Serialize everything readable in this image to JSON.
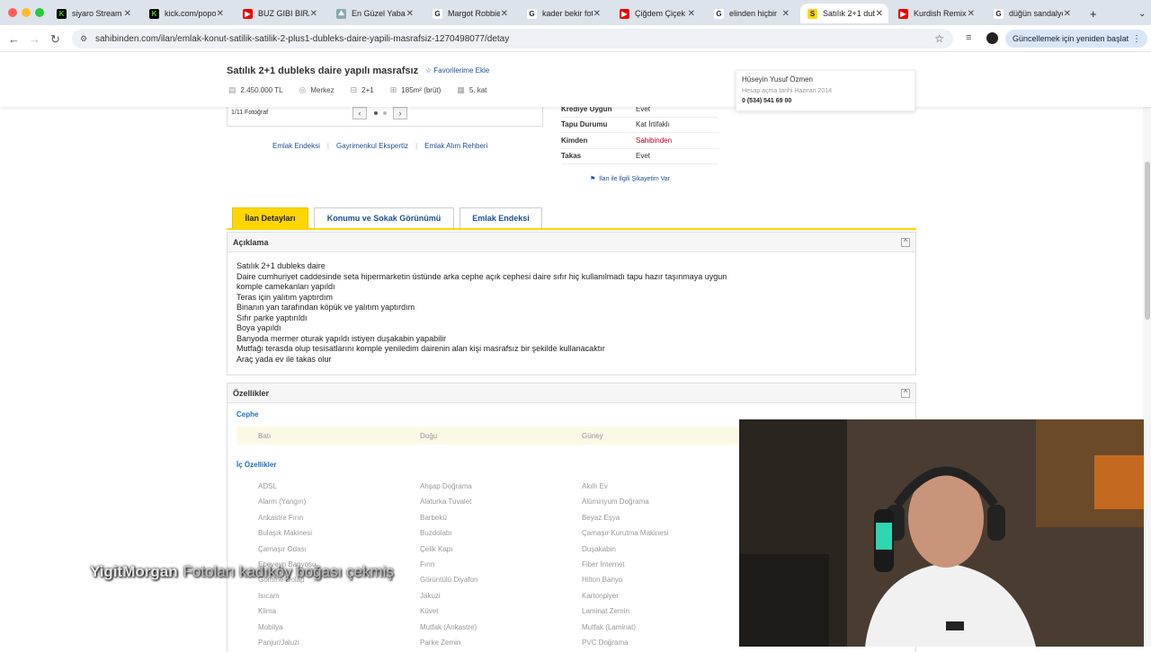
{
  "browser": {
    "tabs": [
      {
        "label": "siyaro Stream",
        "icon_color": "#52d01a",
        "icon_char": "K"
      },
      {
        "label": "kick.com/popo",
        "icon_color": "#52d01a",
        "icon_char": "K"
      },
      {
        "label": "BUZ GIBI BIRA",
        "icon_color": "#e00",
        "icon_char": "▶"
      },
      {
        "label": "En Güzel Yaban",
        "icon_color": "#8aa",
        "icon_char": "⛰"
      },
      {
        "label": "Margot Robbie",
        "icon_color": "#fff",
        "icon_char": "G"
      },
      {
        "label": "kader bekir foto",
        "icon_color": "#fff",
        "icon_char": "G"
      },
      {
        "label": "Çiğdem Çiçek",
        "icon_color": "#e00",
        "icon_char": "▶"
      },
      {
        "label": "elinden hiçbir",
        "icon_color": "#fff",
        "icon_char": "G"
      },
      {
        "label": "Satılık 2+1 dub",
        "icon_color": "#ffd600",
        "icon_char": "S"
      },
      {
        "label": "Kurdish Remix",
        "icon_color": "#e00",
        "icon_char": "▶"
      },
      {
        "label": "düğün sandalye",
        "icon_color": "#fff",
        "icon_char": "G"
      }
    ],
    "new_tab": "+",
    "url": "sahibinden.com/ilan/emlak-konut-satilik-satilik-2-plus1-dubleks-daire-yapili-masrafsiz-1270498077/detay",
    "relaunch_label": "Güncellemek için yeniden başlat"
  },
  "listing": {
    "title": "Satılık 2+1 dubleks daire yapılı masrafsız",
    "favorite_label": "Favorilerime Ekle",
    "facts": [
      {
        "icon": "price-icon",
        "text": "2.450.000 TL"
      },
      {
        "icon": "location-icon",
        "text": "Merkez"
      },
      {
        "icon": "rooms-icon",
        "text": "2+1"
      },
      {
        "icon": "area-icon",
        "text": "185m² (brüt)"
      },
      {
        "icon": "floor-icon",
        "text": "5. kat"
      }
    ],
    "photo_count": "1/11 Fotoğraf"
  },
  "owner": {
    "name": "Hüseyin Yusuf Özmen",
    "since": "Hesap açma tarihi  Haziran 2014",
    "phone": "0 (534) 541 69 00"
  },
  "info_table": [
    {
      "key": "Krediye Uygun",
      "value": "Evet"
    },
    {
      "key": "Tapu Durumu",
      "value": "Kat İrtifaklı"
    },
    {
      "key": "Kimden",
      "value": "Sahibinden"
    },
    {
      "key": "Takas",
      "value": "Evet"
    }
  ],
  "complaint_label": "İlan ile İlgili Şikayetim Var",
  "ext_links": [
    "Emlak Endeksi",
    "Gayrimenkul Ekspertiz",
    "Emlak Alım Rehberi"
  ],
  "detail_tabs": [
    "İlan Detayları",
    "Konumu ve Sokak Görünümü",
    "Emlak Endeksi"
  ],
  "description": {
    "heading": "Açıklama",
    "lines": [
      "Satılık 2+1 dubleks daire",
      "Daire cumhuriyet caddesinde seta hipermarketin üstünde arka cephe açık cephesi daire sıfır hiç kullanılmadı tapu hazır taşınmaya uygun",
      "komple camekanları yapıldı",
      "Teras için yalıtım yaptırdım",
      "Binanın yan tarafından köpük ve yalıtım yaptırdım",
      "Sıfır parke yaptırıldı",
      "Boya yapıldı",
      "Banyoda mermer oturak yapıldı istiyen duşakabin yapabilir",
      "Mutfağı terasda olup tesisatlarını komple yeniledim dairenin alan kişi masrafsız bir şekilde kullanacaktır",
      "Araç yada ev ile takas olur"
    ]
  },
  "features": {
    "heading": "Özellikler",
    "cephe_label": "Cephe",
    "cephe": [
      "Batı",
      "Doğu",
      "Güney"
    ],
    "ic_label": "İç Özellikler",
    "ic": [
      [
        "ADSL",
        "Ahşap Doğrama",
        "Akıllı Ev"
      ],
      [
        "Alarm (Yangın)",
        "Alaturka Tuvalet",
        "Alüminyum Doğrama"
      ],
      [
        "Ankastre Fırın",
        "Barbekü",
        "Beyaz Eşya"
      ],
      [
        "Bulaşık Makinesi",
        "Buzdolabı",
        "Çamaşır Kurutma Makinesi"
      ],
      [
        "Çamaşır Odası",
        "Çelik Kapı",
        "Duşakabin"
      ],
      [
        "Ebeveyn Banyosu",
        "Fırın",
        "Fiber İnternet"
      ],
      [
        "Gömme Dolap",
        "Görüntülü Diyafon",
        "Hilton Banyo"
      ],
      [
        "Isıcam",
        "Jakuzi",
        "Kartonpiyer"
      ],
      [
        "Klima",
        "Küvet",
        "Laminat Zemin"
      ],
      [
        "Mobilya",
        "Mutfak (Ankastre)",
        "Mutfak (Laminat)"
      ],
      [
        "Panjur/Jaluzi",
        "Parke Zemin",
        "PVC Doğrama"
      ]
    ]
  },
  "stream_overlay": {
    "username": "YigitMorgan",
    "message": "Fotoları kadıköy boğası çekmiş"
  }
}
